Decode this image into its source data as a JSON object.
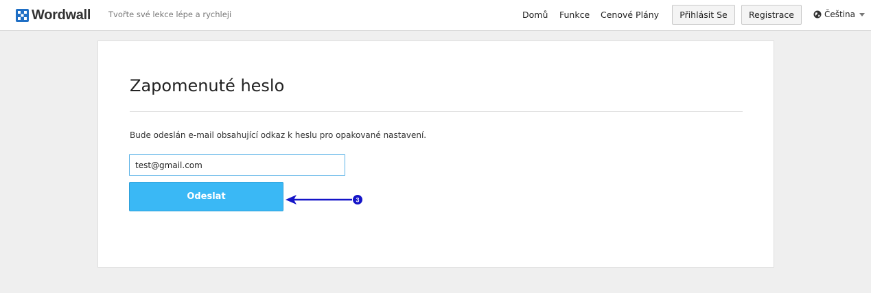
{
  "header": {
    "logo_text": "Wordwall",
    "tagline": "Tvořte své lekce lépe a rychleji",
    "nav": {
      "home": "Domů",
      "features": "Funkce",
      "pricing": "Cenové Plány"
    },
    "login_label": "Přihlásit Se",
    "register_label": "Registrace",
    "language_label": "Čeština"
  },
  "form": {
    "title": "Zapomenuté heslo",
    "description": "Bude odeslán e-mail obsahující odkaz k heslu pro opakované nastavení.",
    "email_value": "test@gmail.com",
    "submit_label": "Odeslat"
  },
  "annotation": {
    "step_number": "3",
    "color": "#1414c8"
  },
  "colors": {
    "background": "#efefef",
    "accent": "#3ab8f5",
    "input_border": "#5ab2e6",
    "annotation": "#1414c8"
  }
}
